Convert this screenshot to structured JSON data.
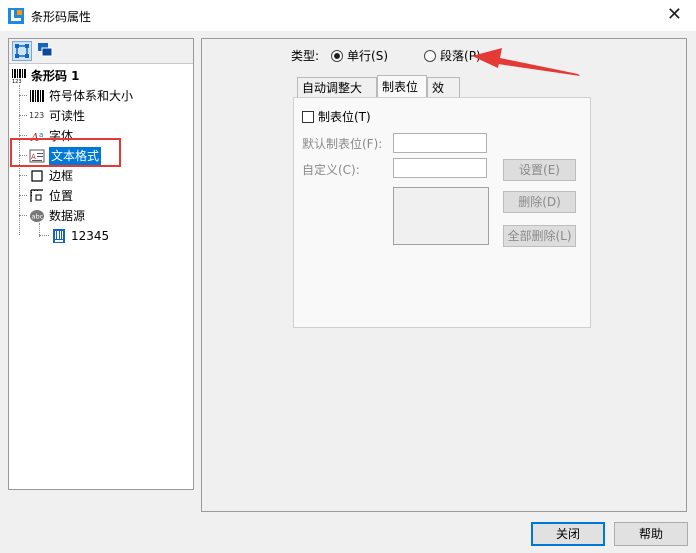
{
  "window": {
    "title": "条形码属性"
  },
  "tree": {
    "root": "条形码 1",
    "items": [
      {
        "label": "符号体系和大小",
        "icon": "barcode-icon"
      },
      {
        "label": "可读性",
        "icon": "digits-icon"
      },
      {
        "label": "字体",
        "icon": "font-icon"
      },
      {
        "label": "文本格式",
        "icon": "text-format-icon",
        "selected": true
      },
      {
        "label": "边框",
        "icon": "border-icon"
      },
      {
        "label": "位置",
        "icon": "position-icon"
      },
      {
        "label": "数据源",
        "icon": "datasource-icon"
      }
    ],
    "sub_item": "12345"
  },
  "type": {
    "label": "类型:",
    "options": [
      {
        "label": "单行(S)",
        "checked": true
      },
      {
        "label": "段落(P)",
        "checked": false
      }
    ]
  },
  "tabs": [
    {
      "label": "自动调整大小",
      "active": false
    },
    {
      "label": "制表位",
      "active": true
    },
    {
      "label": "效果",
      "active": false
    }
  ],
  "tabstop": {
    "checkbox_label": "制表位(T)",
    "default_label": "默认制表位(F):",
    "default_value": "",
    "custom_label": "自定义(C):",
    "custom_value": "",
    "set_button": "设置(E)",
    "delete_button": "删除(D)",
    "delete_all_button": "全部删除(L)"
  },
  "footer": {
    "close": "关闭",
    "help": "帮助"
  },
  "colors": {
    "accent": "#0078d7",
    "annotation": "#e53935"
  }
}
